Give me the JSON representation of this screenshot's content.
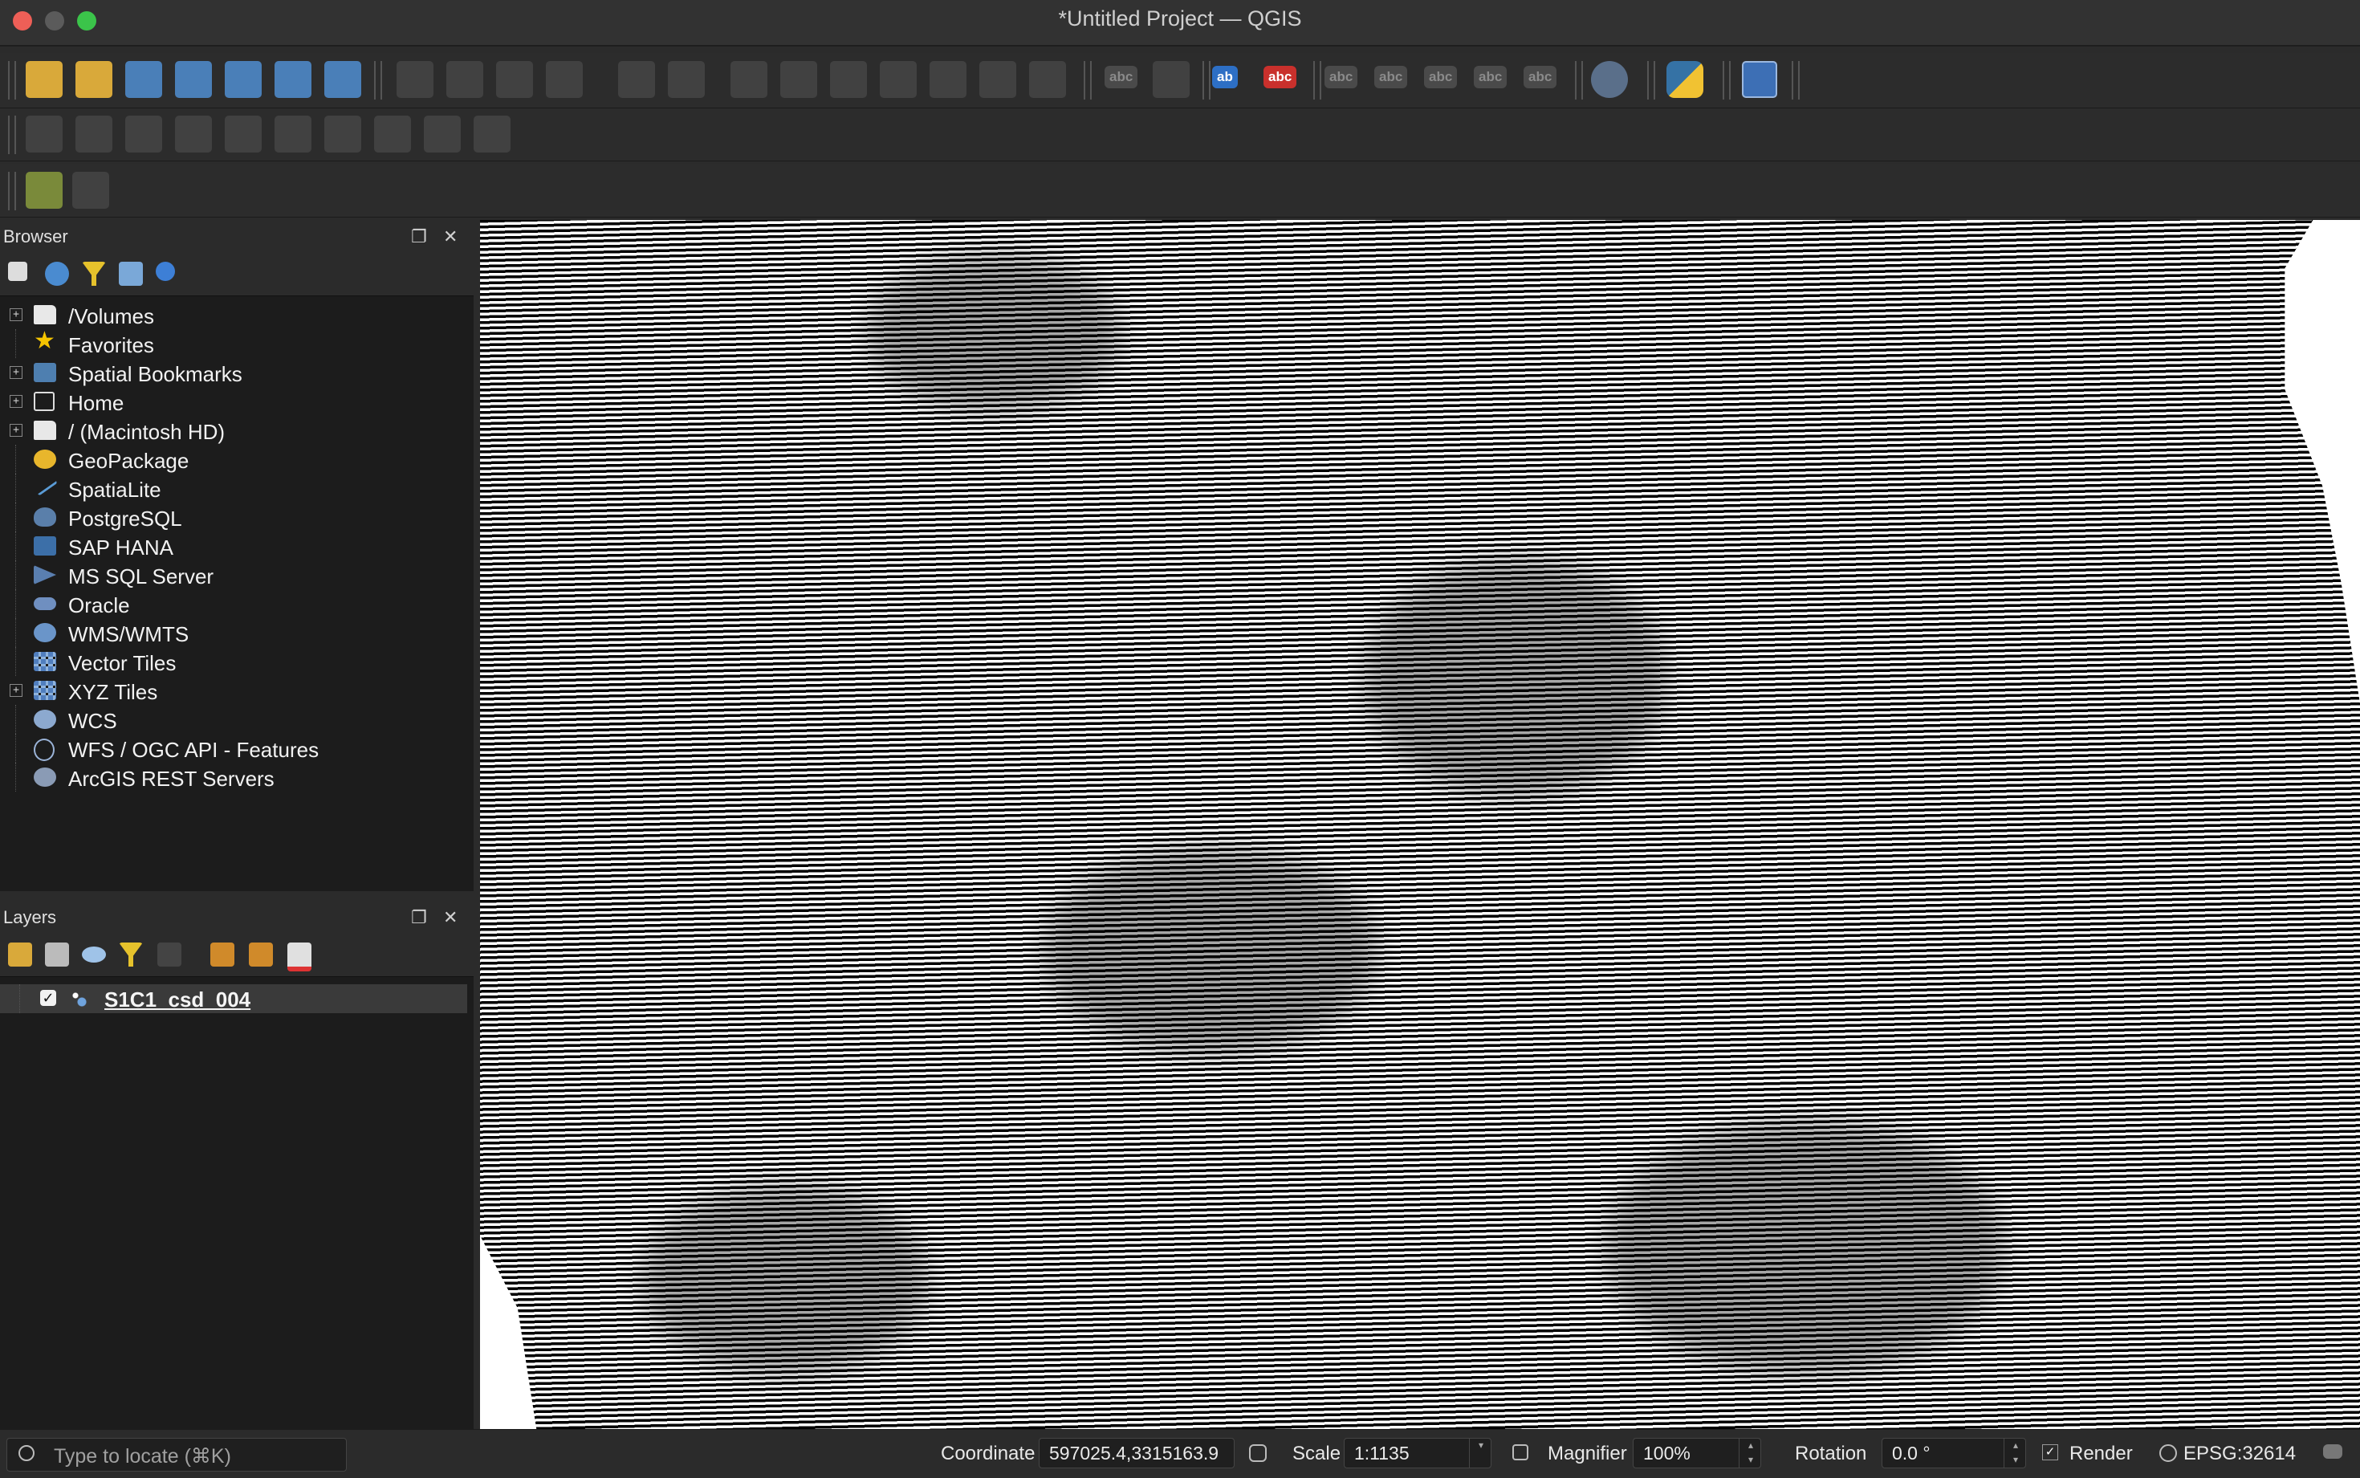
{
  "window": {
    "title": "*Untitled Project — QGIS"
  },
  "browser": {
    "title": "Browser",
    "items": [
      {
        "label": "/Volumes",
        "icon": "folder-icon",
        "expandable": true
      },
      {
        "label": "Favorites",
        "icon": "star-icon",
        "expandable": false
      },
      {
        "label": "Spatial Bookmarks",
        "icon": "bookmark-icon",
        "expandable": true
      },
      {
        "label": "Home",
        "icon": "home-icon",
        "expandable": true
      },
      {
        "label": "/ (Macintosh HD)",
        "icon": "folder-icon",
        "expandable": true
      },
      {
        "label": "GeoPackage",
        "icon": "geopackage-icon",
        "expandable": false
      },
      {
        "label": "SpatiaLite",
        "icon": "spatialite-icon",
        "expandable": false
      },
      {
        "label": "PostgreSQL",
        "icon": "postgresql-icon",
        "expandable": false
      },
      {
        "label": "SAP HANA",
        "icon": "sap-hana-icon",
        "expandable": false
      },
      {
        "label": "MS SQL Server",
        "icon": "mssql-icon",
        "expandable": false
      },
      {
        "label": "Oracle",
        "icon": "oracle-icon",
        "expandable": false
      },
      {
        "label": "WMS/WMTS",
        "icon": "wms-icon",
        "expandable": false
      },
      {
        "label": "Vector Tiles",
        "icon": "vector-tiles-icon",
        "expandable": false
      },
      {
        "label": "XYZ Tiles",
        "icon": "xyz-tiles-icon",
        "expandable": true
      },
      {
        "label": "WCS",
        "icon": "wcs-icon",
        "expandable": false
      },
      {
        "label": "WFS / OGC API - Features",
        "icon": "wfs-icon",
        "expandable": false
      },
      {
        "label": "ArcGIS REST Servers",
        "icon": "arcgis-icon",
        "expandable": false
      }
    ]
  },
  "layers": {
    "title": "Layers",
    "items": [
      {
        "label": "S1C1_csd_004",
        "checked": true
      }
    ]
  },
  "statusbar": {
    "locator_placeholder": "Type to locate (⌘K)",
    "coordinate_label": "Coordinate",
    "coordinate_value": "597025.4,3315163.9",
    "scale_label": "Scale",
    "scale_value": "1:1135",
    "magnifier_label": "Magnifier",
    "magnifier_value": "100%",
    "rotation_label": "Rotation",
    "rotation_value": "0.0 °",
    "render_label": "Render",
    "render_checked": true,
    "crs": "EPSG:32614"
  },
  "toolbar": {
    "abc_labels": [
      "abc",
      "ab",
      "abc",
      "abc",
      "abc",
      "abc",
      "abc",
      "abc"
    ]
  }
}
